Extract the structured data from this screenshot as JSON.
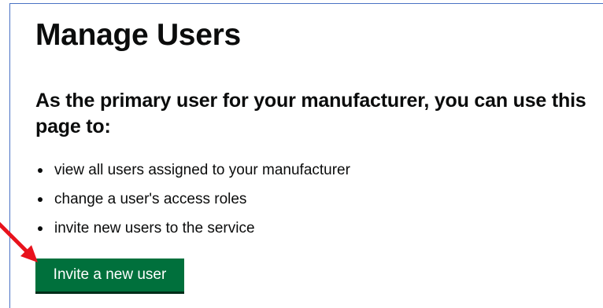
{
  "page": {
    "title": "Manage Users",
    "subheading": "As the primary user for your manufacturer, you can use this page to:",
    "bullets": [
      "view all users assigned to your manufacturer",
      "change a user's access roles",
      "invite new users to the service"
    ]
  },
  "actions": {
    "invite_label": "Invite a new user"
  },
  "colors": {
    "button_green": "#00703c",
    "annotation_arrow": "#e8121c",
    "frame_border": "#4a72c4",
    "text": "#0b0c0c"
  },
  "icons": {
    "annotation": "red-arrow-icon"
  }
}
